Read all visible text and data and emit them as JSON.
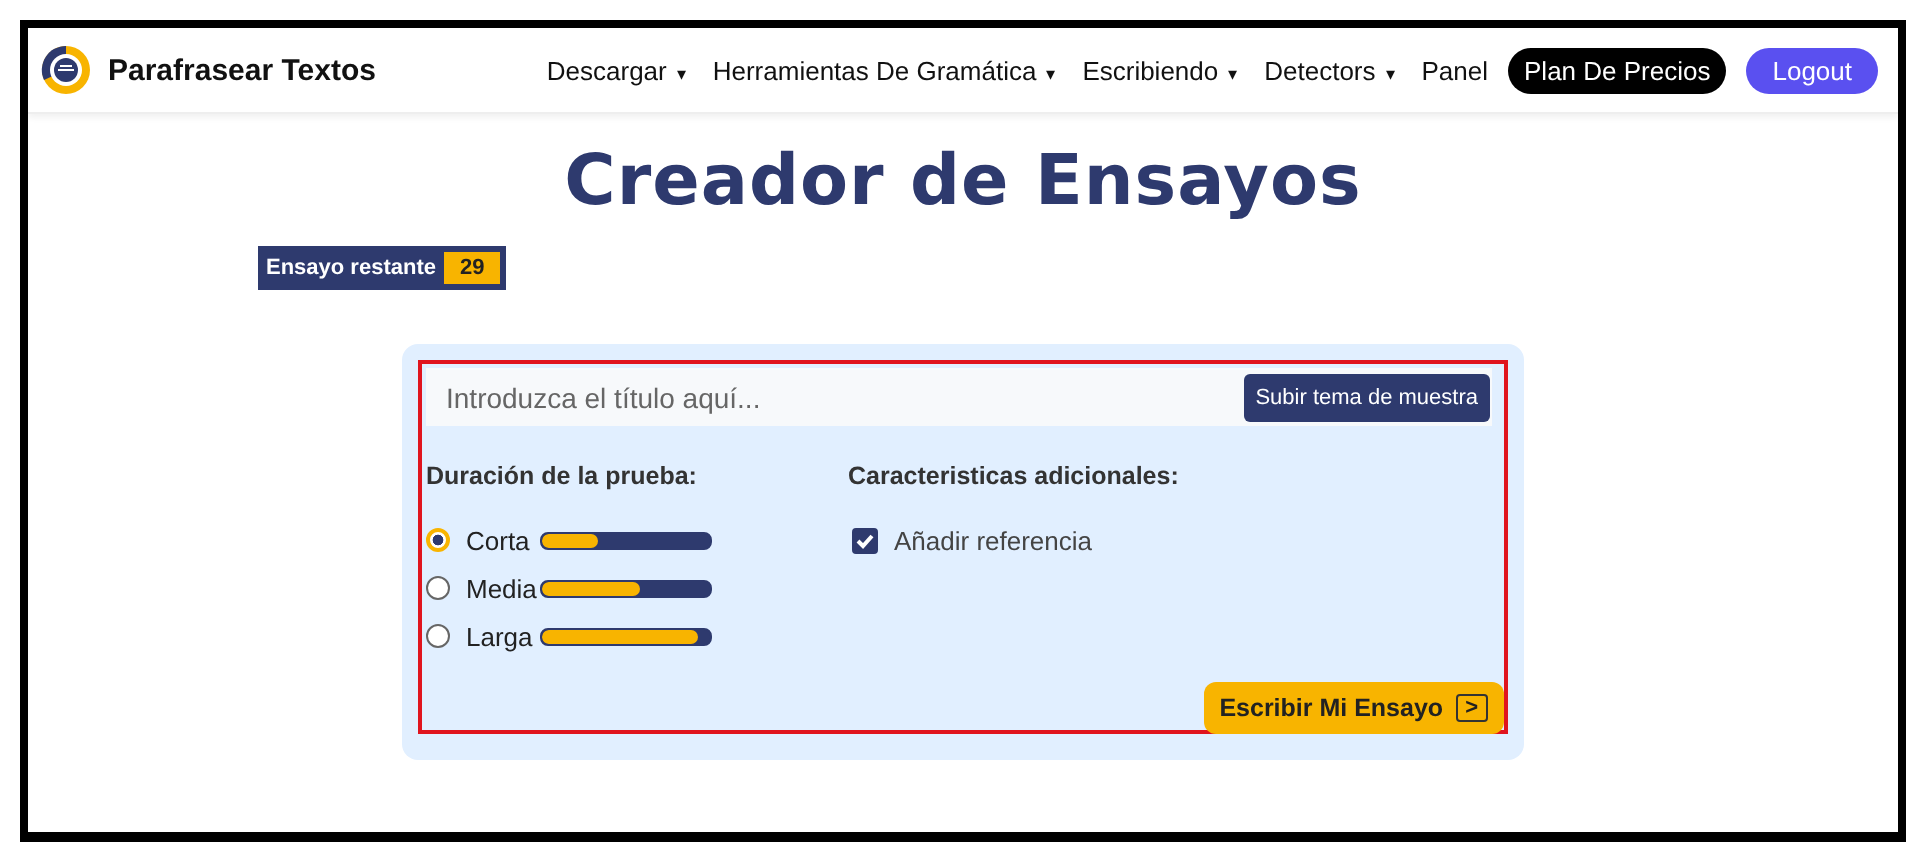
{
  "header": {
    "brand": "Parafrasear Textos",
    "nav": [
      {
        "label": "Descargar",
        "caret": "▾"
      },
      {
        "label": "Herramientas De Gramática",
        "caret": "▾"
      },
      {
        "label": "Escribiendo",
        "caret": "▾"
      },
      {
        "label": "Detectors",
        "caret": "▾"
      },
      {
        "label": "Panel"
      }
    ],
    "buttons": [
      {
        "label": "Plan De Precios",
        "kind": "dark"
      },
      {
        "label": "Logout",
        "kind": "primary"
      }
    ]
  },
  "title": "Creador de Ensayos",
  "remaining": {
    "label": "Ensayo restante",
    "count": "29"
  },
  "form": {
    "title_field": {
      "placeholder": "Introduzca el título aquí..."
    },
    "sample_button": "Subir tema de muestra",
    "duration": {
      "heading": "Duración de la prueba:",
      "options": [
        {
          "label": "Corta",
          "selected": true,
          "level": 0.33
        },
        {
          "label": "Media",
          "selected": false,
          "level": 0.58
        },
        {
          "label": "Larga",
          "selected": false,
          "level": 0.93
        }
      ]
    },
    "features": {
      "heading": "Caracteristicas adicionales:",
      "options": [
        {
          "label": "Añadir referencia",
          "checked": true
        }
      ]
    },
    "submit": {
      "label": "Escribir Mi Ensayo",
      "arrow": ">"
    }
  }
}
